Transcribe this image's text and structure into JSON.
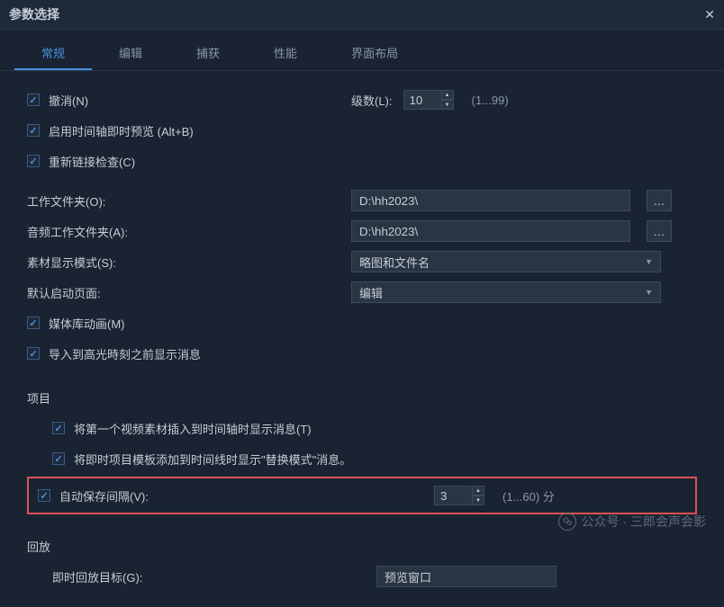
{
  "window": {
    "title": "参数选择"
  },
  "tabs": {
    "general": "常规",
    "edit": "编辑",
    "capture": "捕获",
    "performance": "性能",
    "layout": "界面布局"
  },
  "general": {
    "undo": "撤消(N)",
    "levels_label": "级数(L):",
    "levels_value": "10",
    "levels_hint": "(1...99)",
    "timeline_preview": "启用时间轴即时预览 (Alt+B)",
    "relink_check": "重新链接检查(C)",
    "work_folder_label": "工作文件夹(O):",
    "work_folder_value": "D:\\hh2023\\",
    "audio_folder_label": "音频工作文件夹(A):",
    "audio_folder_value": "D:\\hh2023\\",
    "display_mode_label": "素材显示模式(S):",
    "display_mode_value": "略图和文件名",
    "startup_page_label": "默认启动页面:",
    "startup_page_value": "编辑",
    "media_animation": "媒体库动画(M)",
    "highlight_msg": "导入到高光時刻之前显示消息"
  },
  "project": {
    "title": "项目",
    "first_clip_msg": "将第一个视频素材插入到时间轴时显示消息(T)",
    "replace_mode_msg": "将即时项目模板添加到时间线时显示\"替换模式\"消息。",
    "autosave_label": "自动保存间隔(V):",
    "autosave_value": "3",
    "autosave_hint": "(1...60) 分"
  },
  "playback": {
    "title": "回放",
    "target_label": "即时回放目标(G):",
    "target_value": "预览窗口"
  },
  "watermark": "公众号 · 三郎会声会影"
}
